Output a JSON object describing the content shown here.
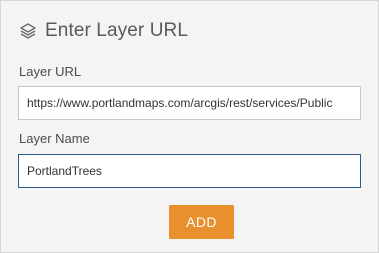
{
  "header": {
    "title": "Enter Layer URL",
    "icon": "layers-icon"
  },
  "form": {
    "url_label": "Layer URL",
    "url_value": "https://www.portlandmaps.com/arcgis/rest/services/Public",
    "name_label": "Layer Name",
    "name_value": "PortlandTrees"
  },
  "actions": {
    "add_label": "ADD"
  },
  "colors": {
    "accent": "#e8902e",
    "panel_background": "#f4f4f4",
    "focus_border": "#2d5c8a"
  }
}
